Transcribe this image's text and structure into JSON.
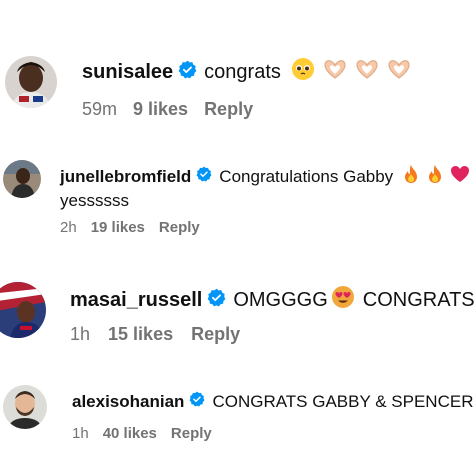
{
  "comments": [
    {
      "username": "sunisalee",
      "text": "congrats",
      "emojis": [
        "pleading-face-icon",
        "heart-hands-icon",
        "heart-hands-icon",
        "heart-hands-icon"
      ],
      "time": "59m",
      "likes": "9 likes",
      "reply": "Reply"
    },
    {
      "username": "junellebromfield",
      "text": "Congratulations Gabby",
      "text_line2": "yessssss",
      "emojis": [
        "fire-icon",
        "fire-icon",
        "red-heart-icon"
      ],
      "time": "2h",
      "likes": "19 likes",
      "reply": "Reply"
    },
    {
      "username": "masai_russell",
      "text": "OMGGGG",
      "text_after": "CONGRATS",
      "emojis": [
        "heart-eyes-face-icon"
      ],
      "time": "1h",
      "likes": "15 likes",
      "reply": "Reply"
    },
    {
      "username": "alexisohanian",
      "text": "CONGRATS GABBY & SPENCER!",
      "time": "1h",
      "likes": "40 likes",
      "reply": "Reply"
    }
  ],
  "colors": {
    "verified": "#0095f6",
    "meta": "#737373",
    "text": "#111111"
  }
}
